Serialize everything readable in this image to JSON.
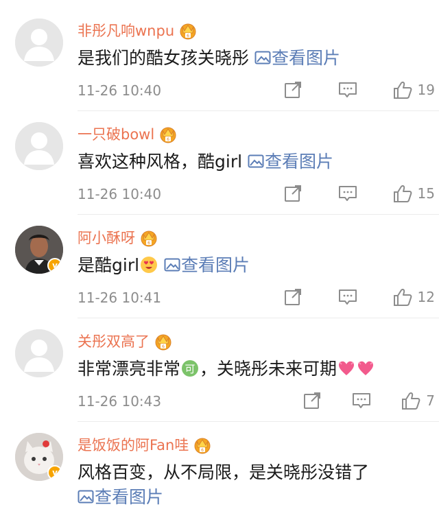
{
  "comments": [
    {
      "username": "非彤凡响wnpu",
      "text": "是我们的酷女孩关晓彤",
      "image_link": "查看图片",
      "time": "11-26 10:40",
      "likes": "19",
      "verified": false
    },
    {
      "username": "一只破bowl",
      "text": "喜欢这种风格，酷girl",
      "image_link": "查看图片",
      "time": "11-26 10:40",
      "likes": "15",
      "verified": false
    },
    {
      "username": "阿小酥呀",
      "text": "是酷girl",
      "image_link": "查看图片",
      "time": "11-26 10:41",
      "likes": "12",
      "verified": true
    },
    {
      "username": "关彤双高了",
      "text_part1": "非常漂亮非常",
      "text_part2": "，关晓彤未来可期",
      "time": "11-26 10:43",
      "likes": "7",
      "verified": false
    },
    {
      "username": "是饭饭的阿Fan哇",
      "text": "风格百变，从不局限，是关晓彤没错了",
      "image_link": "查看图片",
      "verified": true
    }
  ],
  "colors": {
    "username": "#eb7350",
    "link": "#5b7db6",
    "meta": "#8c8c8c",
    "badge": "#f7a400"
  }
}
